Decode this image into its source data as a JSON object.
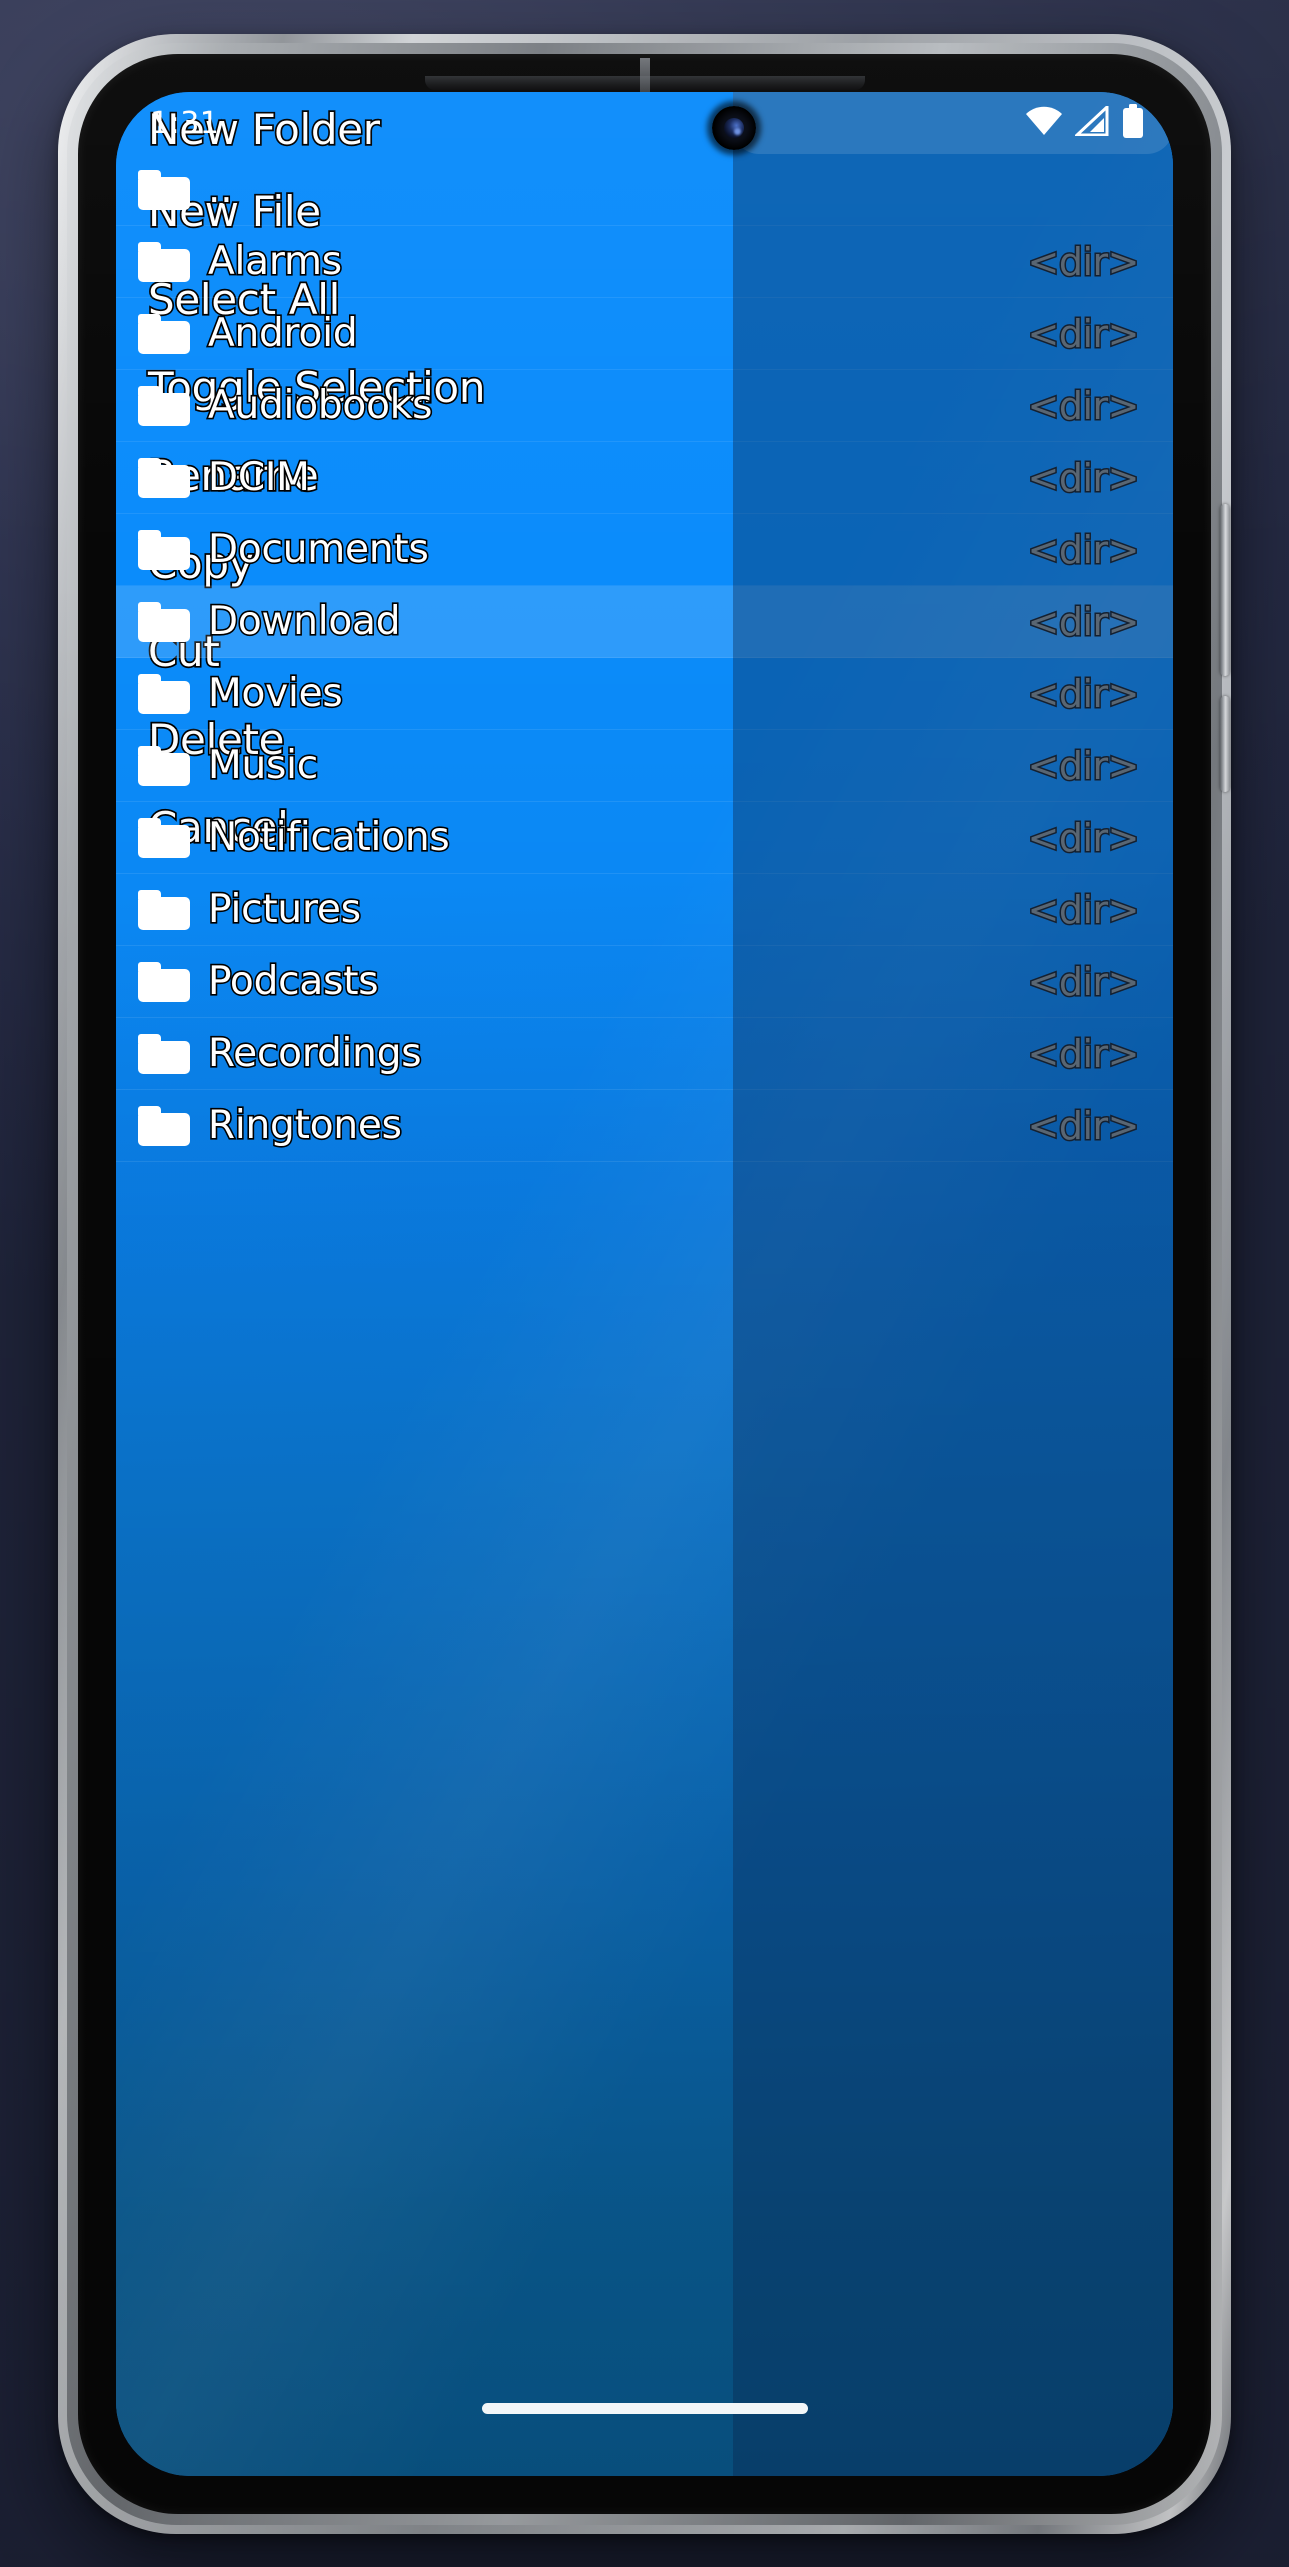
{
  "device": {
    "camera_icon": "front-camera-punch-hole",
    "earpiece_icon": "earpiece-speaker",
    "power_button": "power-button",
    "volume_button": "volume-button",
    "home_indicator": "home-gesture-indicator"
  },
  "statusbar": {
    "time": "1:31",
    "icons": [
      {
        "name": "wifi-icon",
        "glyph": "wifi"
      },
      {
        "name": "cellular-signal-icon",
        "glyph": "signal"
      },
      {
        "name": "battery-icon",
        "glyph": "battery"
      }
    ]
  },
  "colors": {
    "accent_blue": "#0b8cfb",
    "deep_blue": "#0a5e95",
    "selected_row": "#2e9ffb",
    "dir_label": "#8e8f8a",
    "text_white": "#ffffff",
    "menu_overlay": "rgba(10,40,80,0.40)"
  },
  "file_list": {
    "columns": [
      "name",
      "size"
    ],
    "rows": [
      {
        "name": "..",
        "size": "",
        "icon": "folder-icon",
        "selected": false
      },
      {
        "name": "Alarms",
        "size": "<dir>",
        "icon": "folder-icon",
        "selected": false
      },
      {
        "name": "Android",
        "size": "<dir>",
        "icon": "folder-icon",
        "selected": false
      },
      {
        "name": "Audiobooks",
        "size": "<dir>",
        "icon": "folder-icon",
        "selected": false
      },
      {
        "name": "DCIM",
        "size": "<dir>",
        "icon": "folder-icon",
        "selected": false
      },
      {
        "name": "Documents",
        "size": "<dir>",
        "icon": "folder-icon",
        "selected": false
      },
      {
        "name": "Download",
        "size": "<dir>",
        "icon": "folder-icon",
        "selected": true
      },
      {
        "name": "Movies",
        "size": "<dir>",
        "icon": "folder-icon",
        "selected": false
      },
      {
        "name": "Music",
        "size": "<dir>",
        "icon": "folder-icon",
        "selected": false
      },
      {
        "name": "Notifications",
        "size": "<dir>",
        "icon": "folder-icon",
        "selected": false
      },
      {
        "name": "Pictures",
        "size": "<dir>",
        "icon": "folder-icon",
        "selected": false
      },
      {
        "name": "Podcasts",
        "size": "<dir>",
        "icon": "folder-icon",
        "selected": false
      },
      {
        "name": "Recordings",
        "size": "<dir>",
        "icon": "folder-icon",
        "selected": false
      },
      {
        "name": "Ringtones",
        "size": "<dir>",
        "icon": "folder-icon",
        "selected": false
      }
    ]
  },
  "context_menu": {
    "items": [
      {
        "label": "New Folder"
      },
      {
        "label": "New File"
      },
      {
        "label": "Select All"
      },
      {
        "label": "Toggle Selection"
      },
      {
        "label": "Rename"
      },
      {
        "label": "Copy"
      },
      {
        "label": "Cut"
      },
      {
        "label": "Delete"
      },
      {
        "label": "Cancel"
      }
    ]
  }
}
